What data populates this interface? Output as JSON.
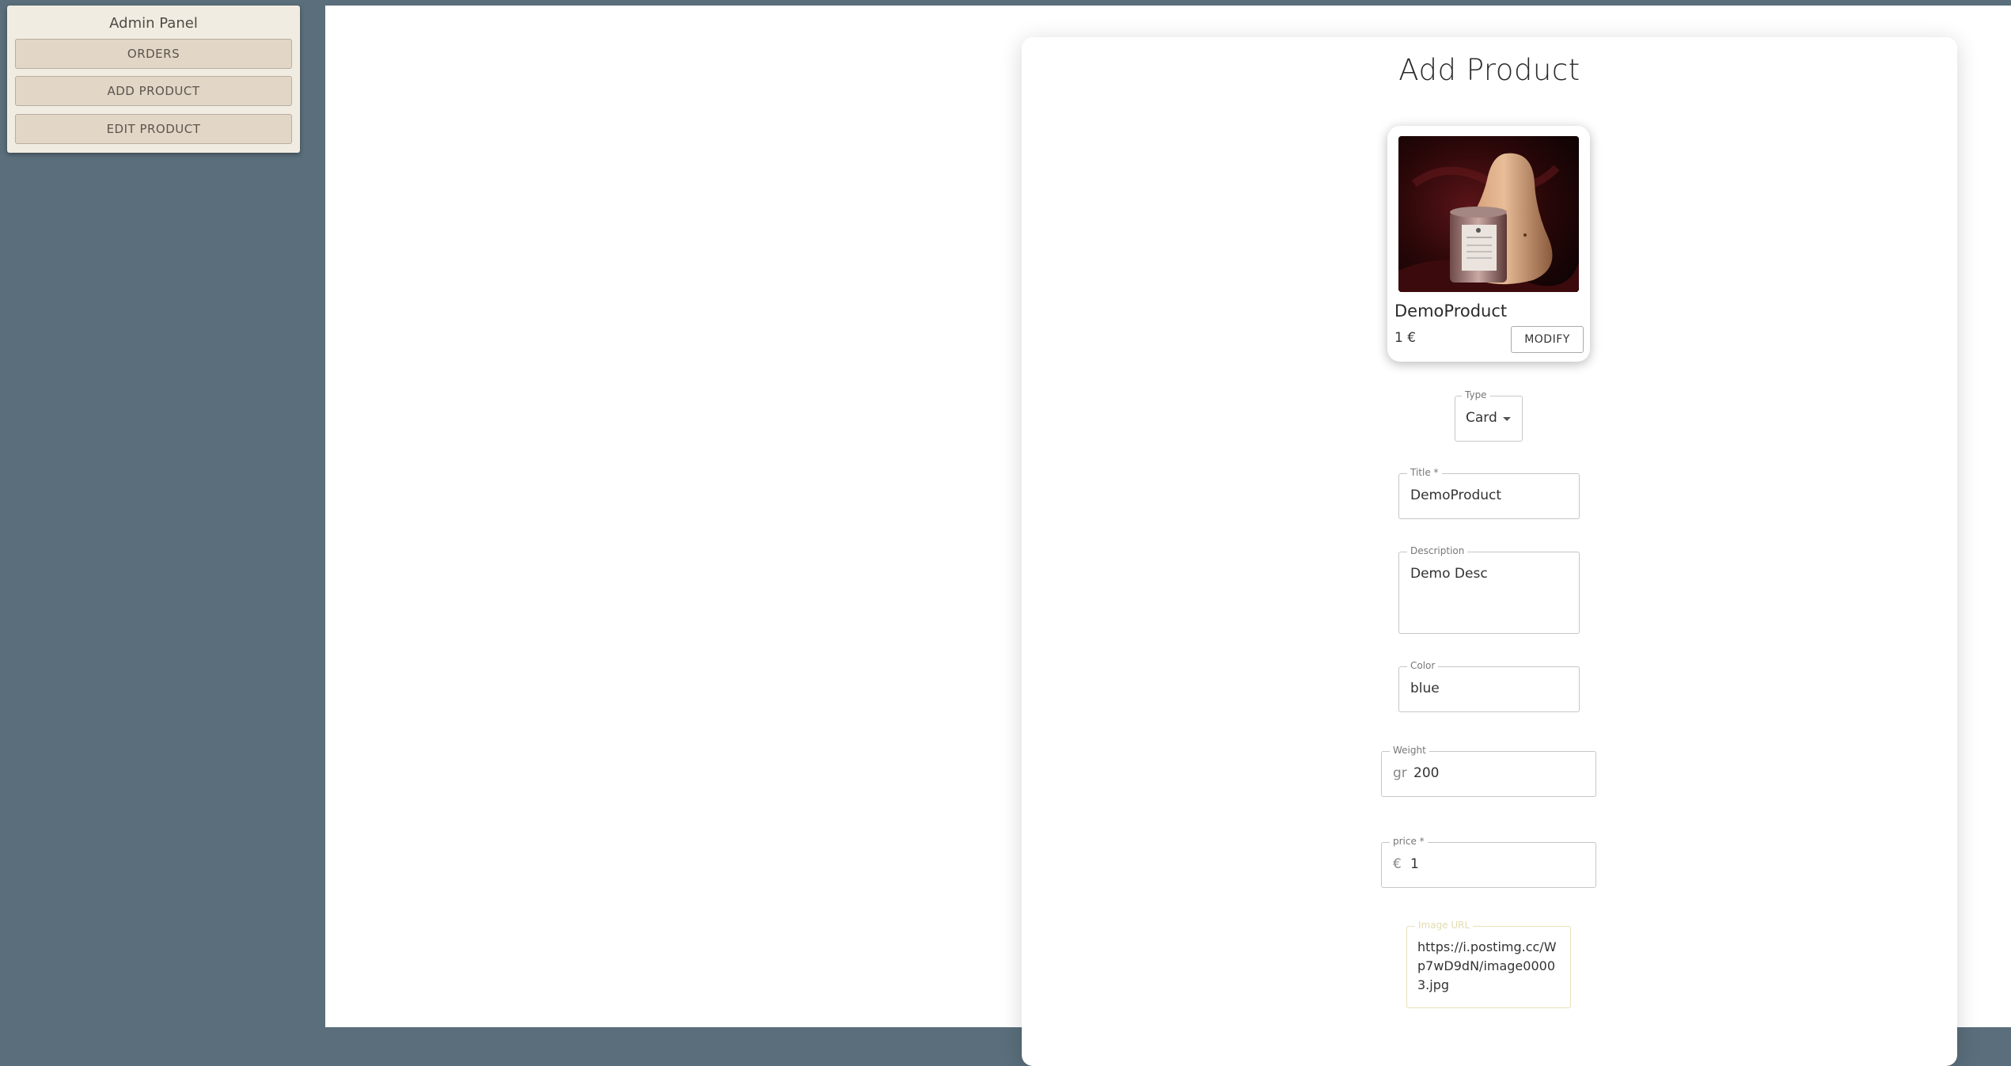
{
  "sidebar": {
    "title": "Admin Panel",
    "buttons": [
      "ORDERS",
      "ADD PRODUCT",
      "EDIT PRODUCT"
    ]
  },
  "page": {
    "title": "Add Product"
  },
  "card": {
    "title": "DemoProduct",
    "price": "1 €",
    "modify_label": "MODIFY"
  },
  "form": {
    "type": {
      "label": "Type",
      "value": "Card"
    },
    "title": {
      "label": "Title *",
      "value": "DemoProduct"
    },
    "description": {
      "label": "Description",
      "value": "Demo Desc"
    },
    "color": {
      "label": "Color",
      "value": "blue"
    },
    "weight": {
      "label": "Weight",
      "adornment": "gr",
      "value": "200"
    },
    "price": {
      "label": "price *",
      "adornment": "€",
      "value": "1"
    },
    "image_url": {
      "label": "Image URL",
      "value": "https://i.postimg.cc/Wp7wD9dN/image00003.jpg"
    }
  },
  "colors": {
    "background": "#5a6e7b",
    "sidebar": "#f1ece2",
    "sidebar_button": "#e2d6c6"
  }
}
